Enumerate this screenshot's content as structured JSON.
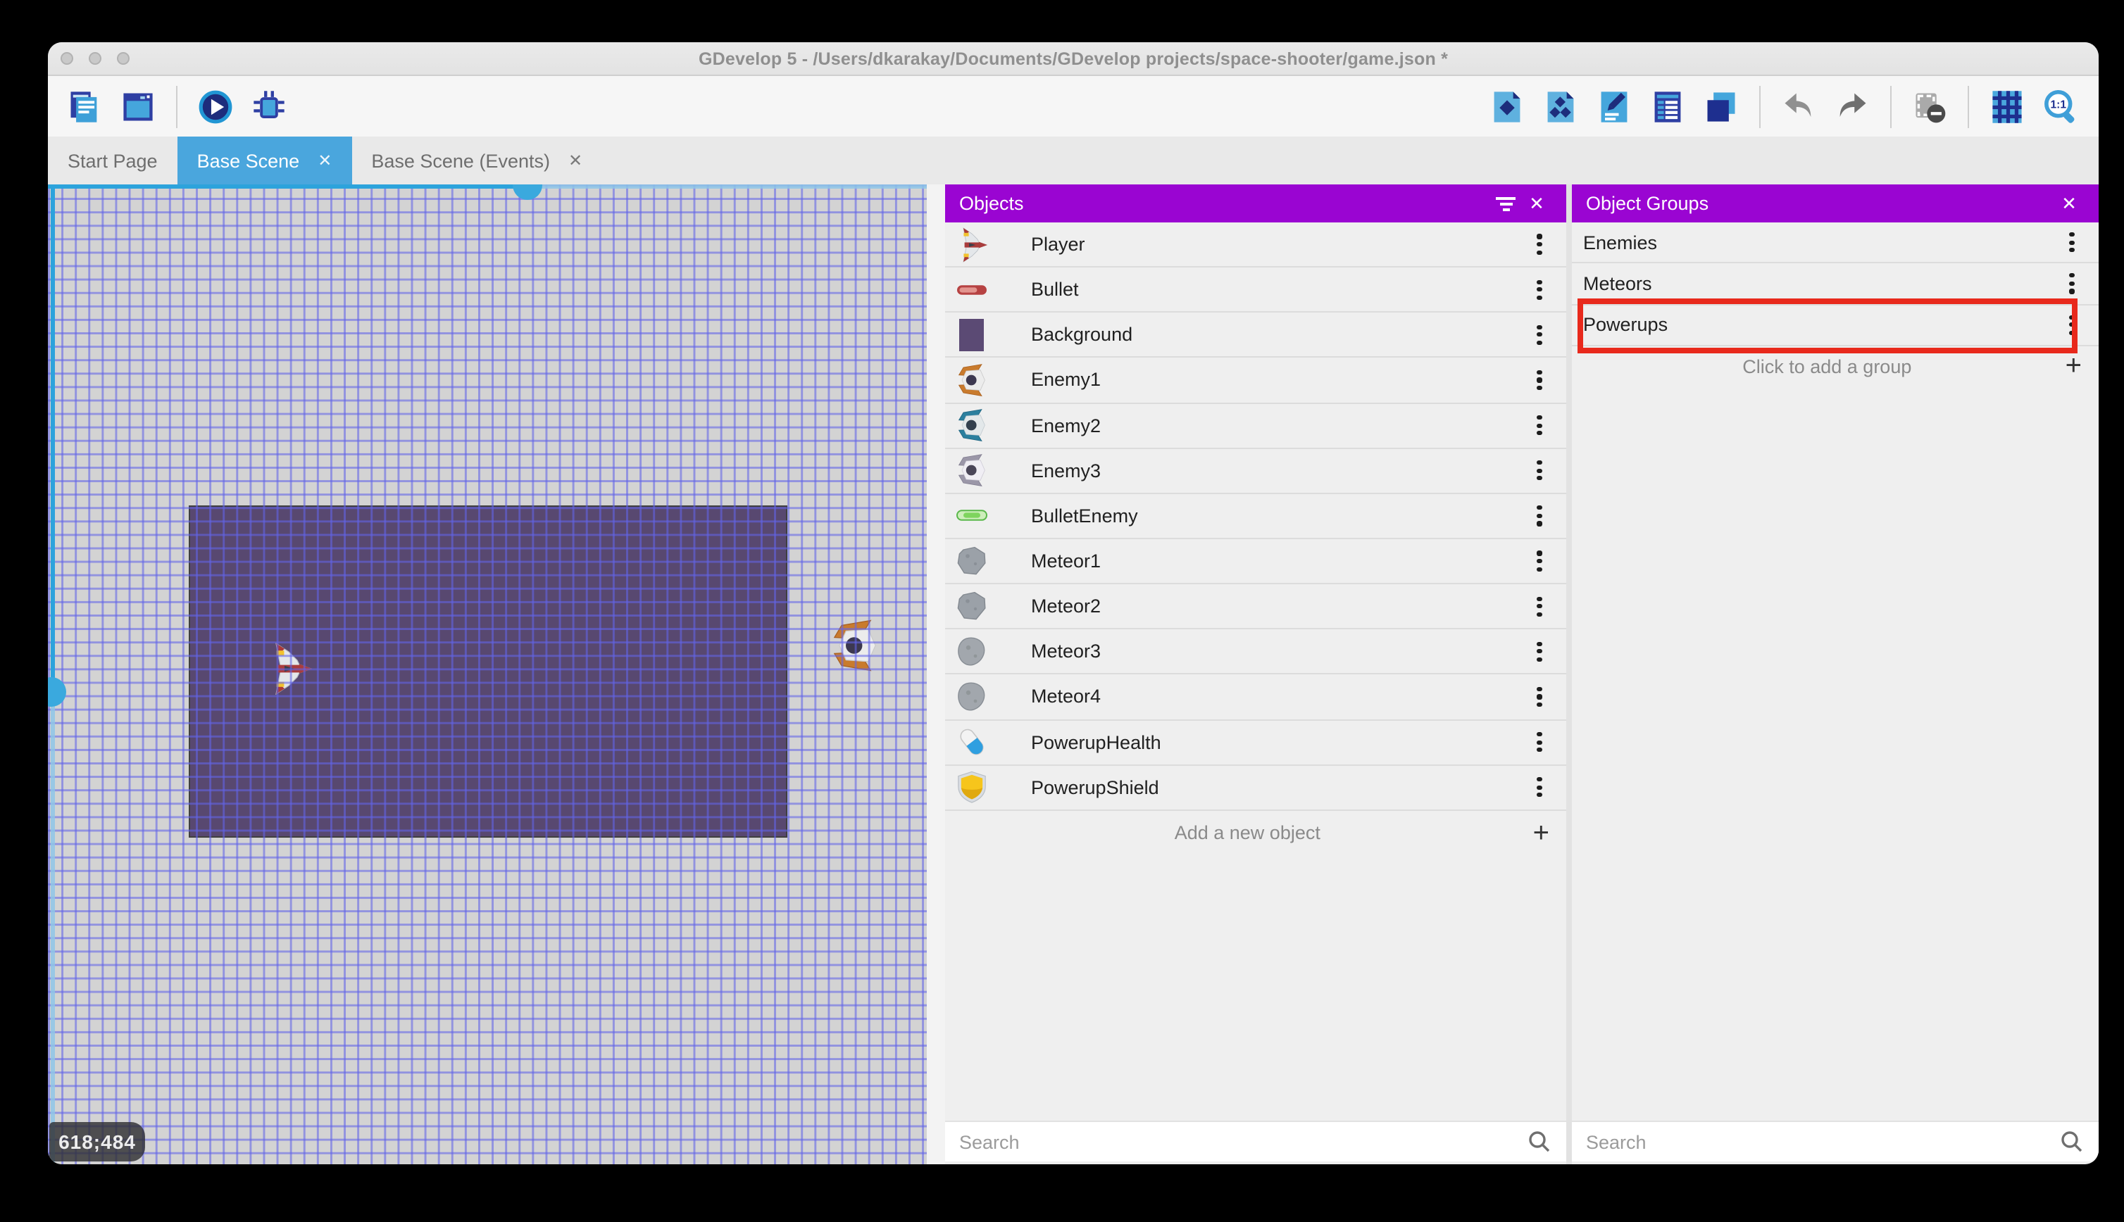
{
  "window": {
    "title": "GDevelop 5 - /Users/dkarakay/Documents/GDevelop projects/space-shooter/game.json *"
  },
  "toolbar": {
    "left_icons": [
      "project-manager",
      "scene-window",
      "separator",
      "play",
      "debug"
    ],
    "right_icons": [
      "objects-editor",
      "object-groups-editor",
      "properties",
      "instances-list",
      "layers",
      "separator",
      "undo",
      "redo",
      "separator",
      "mask",
      "separator",
      "grid",
      "zoom-1-1"
    ]
  },
  "tabs": [
    {
      "label": "Start Page",
      "active": false,
      "closable": false
    },
    {
      "label": "Base Scene",
      "active": true,
      "closable": true
    },
    {
      "label": "Base Scene (Events)",
      "active": false,
      "closable": true
    }
  ],
  "canvas": {
    "coordinates": "618;484"
  },
  "objects_panel": {
    "title": "Objects",
    "items": [
      {
        "label": "Player",
        "icon": "player-ship"
      },
      {
        "label": "Bullet",
        "icon": "bullet-red"
      },
      {
        "label": "Background",
        "icon": "background-square"
      },
      {
        "label": "Enemy1",
        "icon": "enemy-orange"
      },
      {
        "label": "Enemy2",
        "icon": "enemy-teal"
      },
      {
        "label": "Enemy3",
        "icon": "enemy-gray"
      },
      {
        "label": "BulletEnemy",
        "icon": "bullet-green"
      },
      {
        "label": "Meteor1",
        "icon": "meteor-a"
      },
      {
        "label": "Meteor2",
        "icon": "meteor-a"
      },
      {
        "label": "Meteor3",
        "icon": "meteor-b"
      },
      {
        "label": "Meteor4",
        "icon": "meteor-b"
      },
      {
        "label": "PowerupHealth",
        "icon": "pill"
      },
      {
        "label": "PowerupShield",
        "icon": "shield"
      }
    ],
    "add_label": "Add a new object",
    "search_placeholder": "Search"
  },
  "groups_panel": {
    "title": "Object Groups",
    "items": [
      {
        "label": "Enemies",
        "highlighted": false
      },
      {
        "label": "Meteors",
        "highlighted": false
      },
      {
        "label": "Powerups",
        "highlighted": true
      }
    ],
    "add_label": "Click to add a group",
    "search_placeholder": "Search"
  },
  "colors": {
    "panel_header_purple": "#9a05d2",
    "active_tab_blue": "#4aa6dd",
    "scrollbar_blue": "#2ca3dc",
    "highlight_red": "#e8291c",
    "scene_rect_purple": "#584870"
  }
}
